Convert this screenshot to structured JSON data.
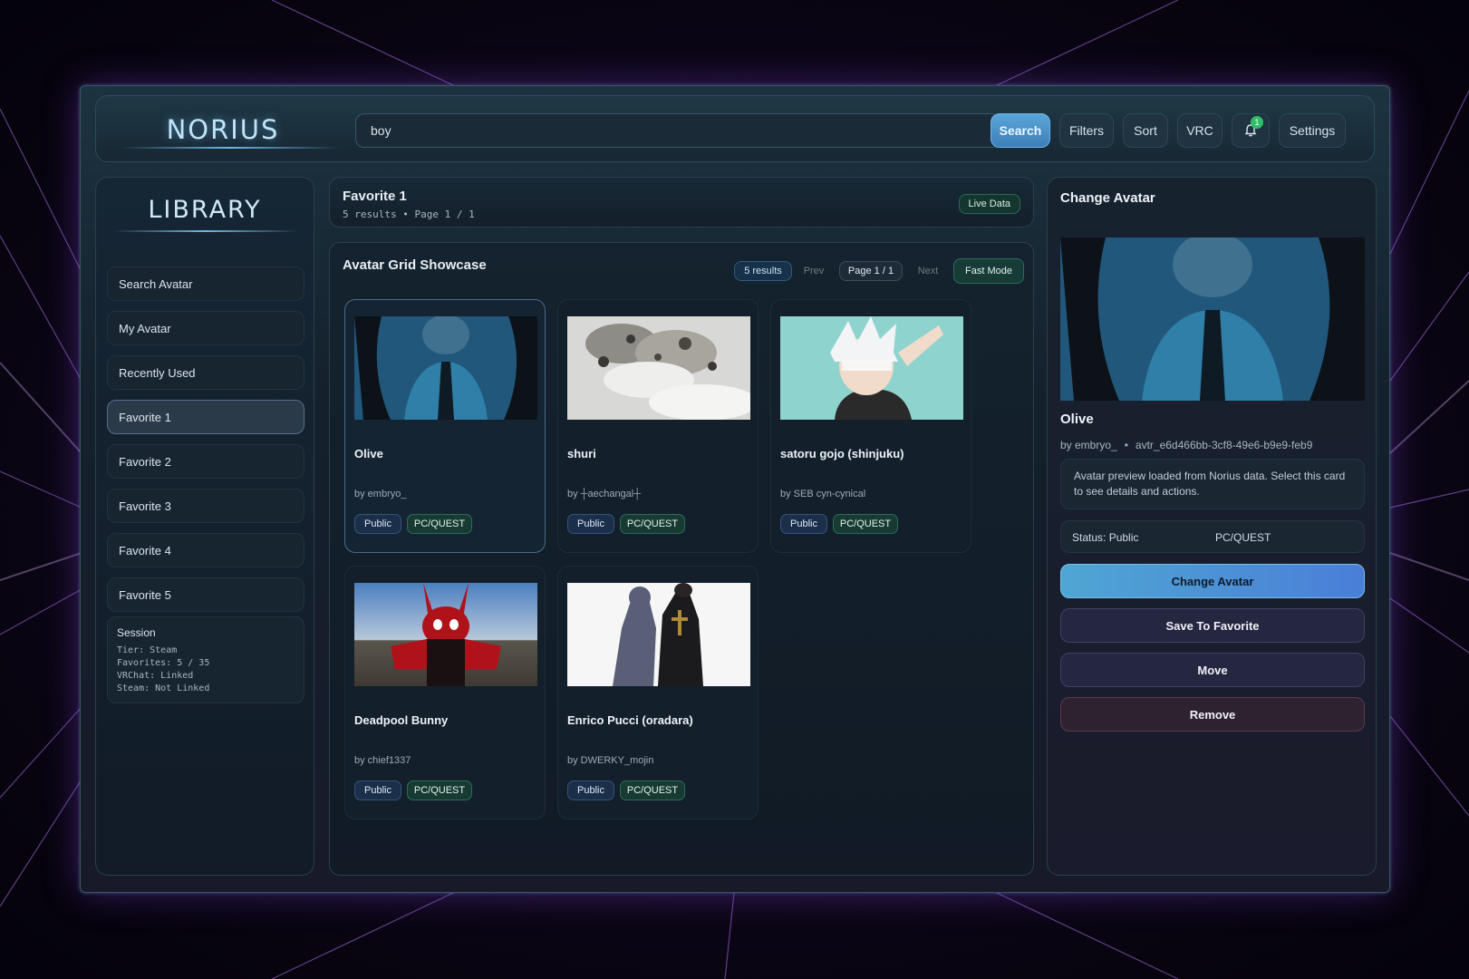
{
  "app": {
    "logo": "NORIUS"
  },
  "topbar": {
    "search_value": "boy",
    "search_label": "Search",
    "filters_label": "Filters",
    "sort_label": "Sort",
    "vrc_label": "VRC",
    "notification_count": "1",
    "settings_label": "Settings"
  },
  "sidebar": {
    "title": "LIBRARY",
    "items": [
      {
        "label": "Search Avatar"
      },
      {
        "label": "My Avatar"
      },
      {
        "label": "Recently Used"
      },
      {
        "label": "Favorite 1"
      },
      {
        "label": "Favorite 2"
      },
      {
        "label": "Favorite 3"
      },
      {
        "label": "Favorite 4"
      },
      {
        "label": "Favorite 5"
      }
    ],
    "session": {
      "title": "Session",
      "lines": [
        "Tier: Steam",
        "Favorites: 5 / 35",
        "VRChat: Linked",
        "Steam: Not Linked"
      ]
    }
  },
  "header": {
    "title": "Favorite 1",
    "subtitle": "5 results  •  Page 1 / 1",
    "live_label": "Live Data"
  },
  "grid": {
    "title": "Avatar Grid Showcase",
    "results_label": "5 results",
    "prev_label": "Prev",
    "page_label": "Page 1 / 1",
    "next_label": "Next",
    "fast_mode_label": "Fast Mode",
    "cards": [
      {
        "name": "Olive",
        "author": "by embryo_",
        "visibility": "Public",
        "platform": "PC/QUEST"
      },
      {
        "name": "shuri",
        "author": "by ┼aechangal┼",
        "visibility": "Public",
        "platform": "PC/QUEST"
      },
      {
        "name": "satoru gojo (shinjuku)",
        "author": "by SEB cyn-cynical",
        "visibility": "Public",
        "platform": "PC/QUEST"
      },
      {
        "name": "Deadpool Bunny",
        "author": "by chief1337",
        "visibility": "Public",
        "platform": "PC/QUEST"
      },
      {
        "name": "Enrico Pucci (oradara)",
        "author": "by DWERKY_mojin",
        "visibility": "Public",
        "platform": "PC/QUEST"
      }
    ]
  },
  "detail": {
    "title": "Change Avatar",
    "name": "Olive",
    "author": "by embryo_",
    "avatar_id": "avtr_e6d466bb-3cf8-49e6-b9e9-feb9",
    "description": "Avatar preview loaded from Norius data. Select this card to see details and actions.",
    "status": "Status: Public",
    "platform": "PC/QUEST",
    "change_label": "Change Avatar",
    "save_label": "Save To Favorite",
    "move_label": "Move",
    "remove_label": "Remove"
  },
  "colors": {
    "accent": "#4fa6d3",
    "public_tag": "#1c2f4a",
    "platform_tag": "#173b33",
    "notification": "#2fbf6b"
  }
}
